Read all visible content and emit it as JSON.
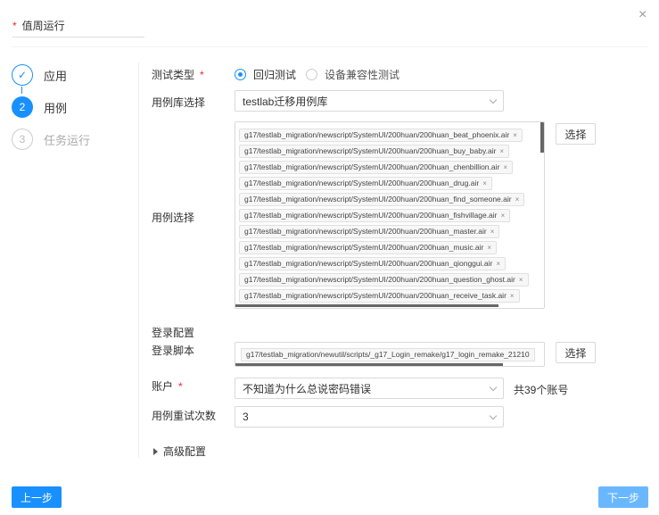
{
  "dialog": {
    "close_label": "×"
  },
  "name_field": {
    "required_mark": "*",
    "value": "值周运行"
  },
  "steps": [
    {
      "number": "✓",
      "label": "应用"
    },
    {
      "number": "2",
      "label": "用例"
    },
    {
      "number": "3",
      "label": "任务运行"
    }
  ],
  "test_type": {
    "label": "测试类型",
    "required_mark": "*",
    "options": [
      "回归测试",
      "设备兼容性测试"
    ],
    "selected_index": 0
  },
  "case_library": {
    "label": "用例库选择",
    "value": "testlab迁移用例库"
  },
  "case_select": {
    "label": "用例选择",
    "button_label": "选择",
    "tags": [
      "g17/testlab_migration/newscript/SystemUI/200huan/200huan_beat_phoenix.air",
      "g17/testlab_migration/newscript/SystemUI/200huan/200huan_buy_baby.air",
      "g17/testlab_migration/newscript/SystemUI/200huan/200huan_chenbillion.air",
      "g17/testlab_migration/newscript/SystemUI/200huan/200huan_drug.air",
      "g17/testlab_migration/newscript/SystemUI/200huan/200huan_find_someone.air",
      "g17/testlab_migration/newscript/SystemUI/200huan/200huan_fishvillage.air",
      "g17/testlab_migration/newscript/SystemUI/200huan/200huan_master.air",
      "g17/testlab_migration/newscript/SystemUI/200huan/200huan_music.air",
      "g17/testlab_migration/newscript/SystemUI/200huan/200huan_qionggui.air",
      "g17/testlab_migration/newscript/SystemUI/200huan/200huan_question_ghost.air",
      "g17/testlab_migration/newscript/SystemUI/200huan/200huan_receive_task.air"
    ],
    "tag_remove": "×"
  },
  "login_config": {
    "section_title": "登录配置",
    "script_label": "登录脚本",
    "script_value": "g17/testlab_migration/newutil/scripts/_g17_Login_remake/g17_login_remake_21210",
    "button_label": "选择"
  },
  "account": {
    "label": "账户",
    "required_mark": "*",
    "value": "不知道为什么总说密码错误",
    "count_text": "共39个账号"
  },
  "retry": {
    "label": "用例重试次数",
    "value": "3"
  },
  "advanced": {
    "label": "高级配置"
  },
  "footer": {
    "prev_label": "上一步",
    "next_label": "下一步"
  }
}
